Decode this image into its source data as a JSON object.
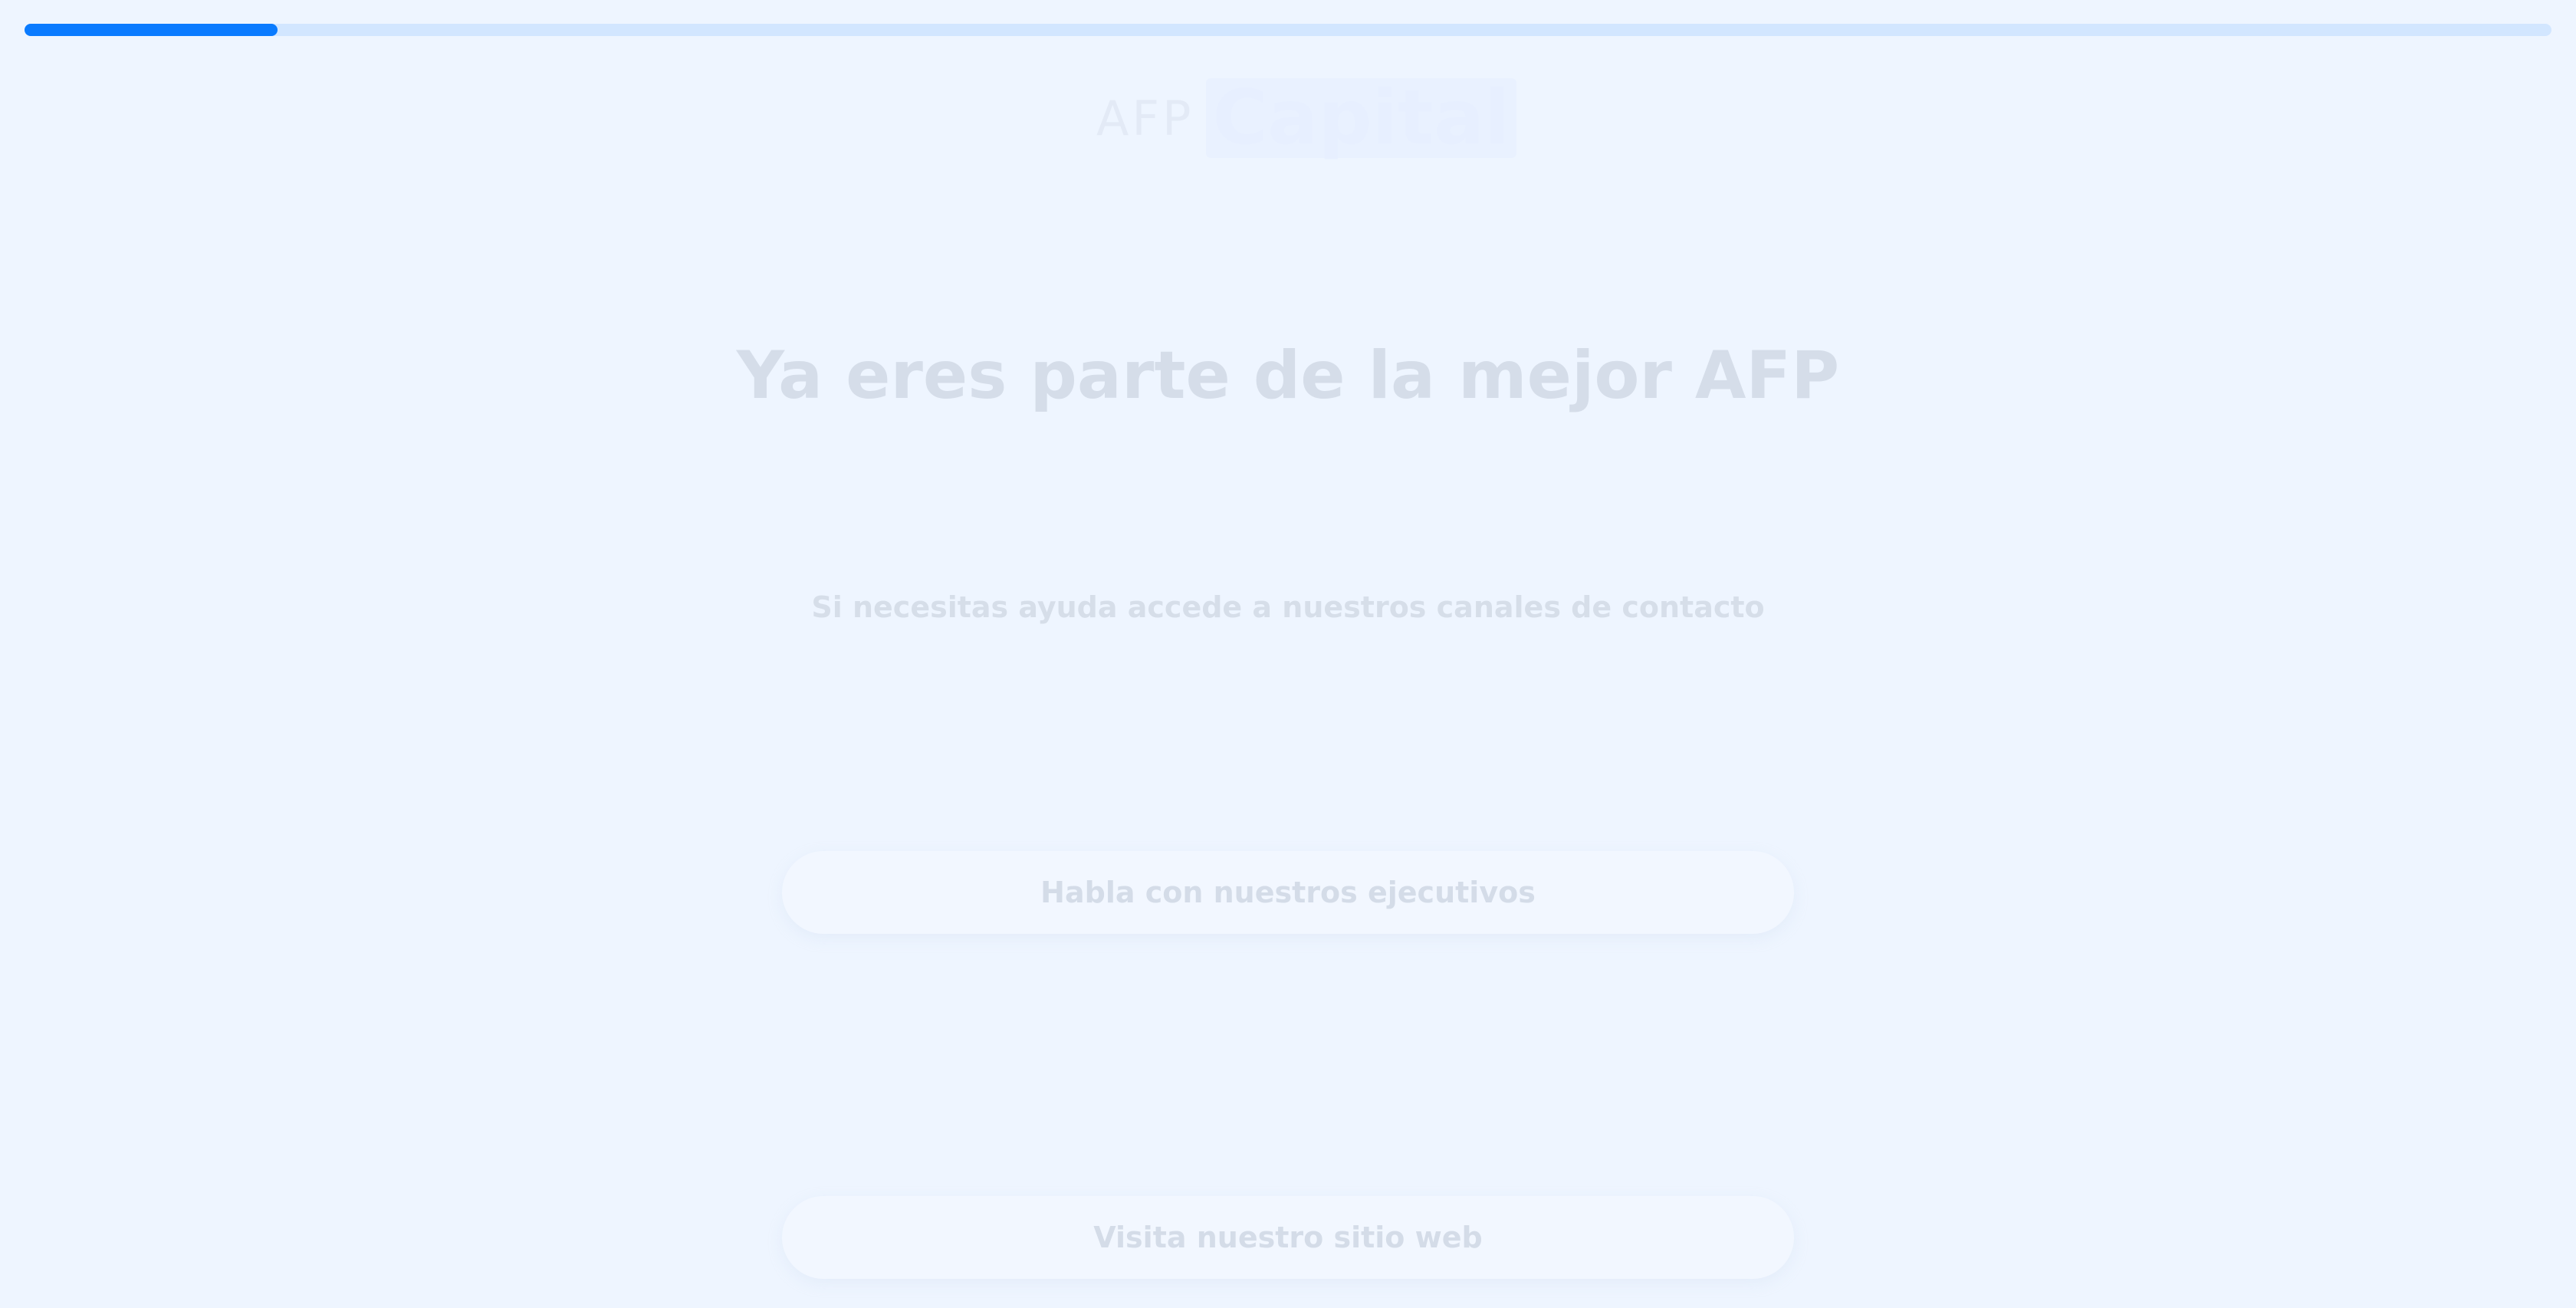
{
  "progress": {
    "value": 0.1
  },
  "logo": {
    "prefix": "AFP",
    "name": "Capital"
  },
  "heading": {
    "title": "Ya eres parte de la mejor AFP"
  },
  "help": {
    "text": "Si necesitas ayuda accede a nuestros canales de contacto"
  },
  "actions": {
    "talk_label": "Habla con nuestros ejecutivos",
    "website_label": "Visita nuestro sitio web"
  },
  "colors": {
    "accent": "#0a7bff",
    "track": "#d2e6ff",
    "background": "#eef5ff"
  }
}
